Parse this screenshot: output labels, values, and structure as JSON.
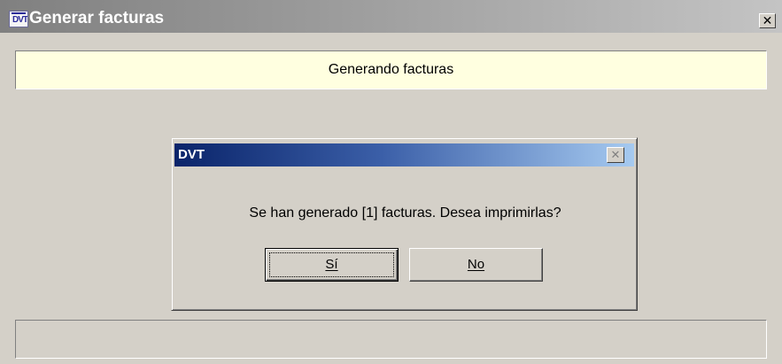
{
  "outer_window": {
    "title": "Generar facturas",
    "icon": "app-document-icon",
    "icon_text": "DVT",
    "close_glyph": "✕"
  },
  "banner": {
    "text": "Generando facturas",
    "background": "#ffffe0"
  },
  "dialog": {
    "title": "DVT",
    "close_glyph": "✕",
    "message": "Se han generado [1] facturas. Desea imprimirlas?",
    "buttons": {
      "yes_label": "Sí",
      "no_label": "No"
    }
  },
  "colors": {
    "window_bg": "#d4d0c8",
    "dialog_title_start": "#0a246a",
    "dialog_title_end": "#a6caf0",
    "outer_title_inactive": "#808080"
  }
}
